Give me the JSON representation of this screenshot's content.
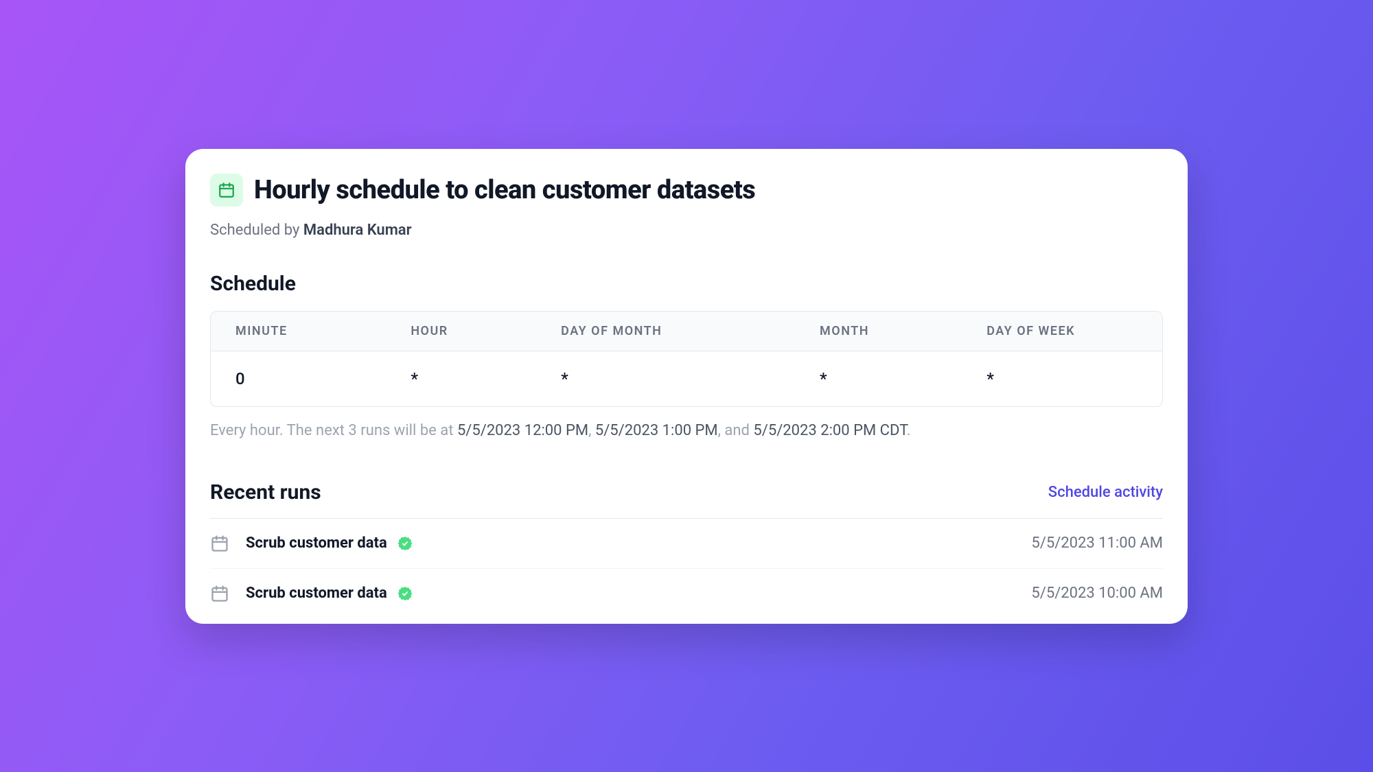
{
  "header": {
    "title": "Hourly schedule to clean customer datasets",
    "scheduled_by_prefix": "Scheduled by ",
    "scheduled_by_name": "Madhura Kumar"
  },
  "schedule": {
    "section_title": "Schedule",
    "columns": {
      "minute": "MINUTE",
      "hour": "HOUR",
      "day_of_month": "DAY OF MONTH",
      "month": "MONTH",
      "day_of_week": "DAY OF WEEK"
    },
    "values": {
      "minute": "0",
      "hour": "*",
      "day_of_month": "*",
      "month": "*",
      "day_of_week": "*"
    },
    "summary": {
      "t1": "Every hour. The next 3 runs will be at ",
      "t2": "5/5/2023 12:00 PM",
      "t3": ", ",
      "t4": "5/5/2023 1:00 PM",
      "t5": ", and ",
      "t6": "5/5/2023 2:00 PM CDT",
      "t7": "."
    }
  },
  "recent": {
    "section_title": "Recent runs",
    "activity_link": "Schedule activity",
    "rows": [
      {
        "name": "Scrub customer data",
        "timestamp": "5/5/2023 11:00 AM"
      },
      {
        "name": "Scrub customer data",
        "timestamp": "5/5/2023 10:00 AM"
      }
    ]
  }
}
